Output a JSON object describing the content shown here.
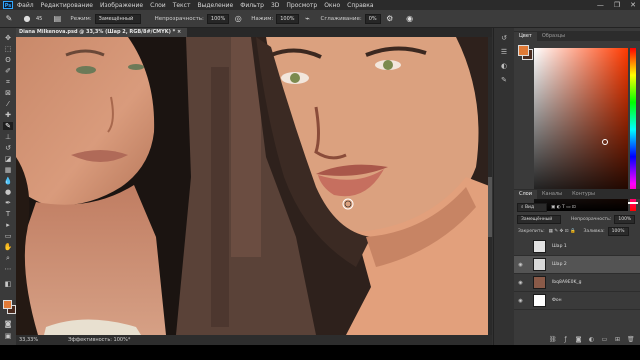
{
  "menubar": {
    "logo": "Ps",
    "items": [
      "Файл",
      "Редактирование",
      "Изображение",
      "Слои",
      "Текст",
      "Выделение",
      "Фильтр",
      "3D",
      "Просмотр",
      "Окно",
      "Справка"
    ],
    "controls": [
      "—",
      "❐",
      "✕"
    ]
  },
  "options": {
    "brush_size": "45",
    "mode_label": "Режим:",
    "mode_value": "Замещённый",
    "opacity_label": "Непрозрачность:",
    "opacity_value": "100%",
    "flow_label": "Нажим:",
    "flow_value": "100%",
    "smoothing_label": "Сглаживание:",
    "smoothing_value": "0%"
  },
  "document": {
    "tab": "Diana Milkenova.psd @ 33,3% (Шар 2, RGB/8#/CMYK) * ×",
    "zoom": "33,33%",
    "efficiency": "Эффективность: 100%*"
  },
  "colors": {
    "foreground": "#e07a36",
    "background": "#4a2b1f"
  },
  "color_panel": {
    "tabs": [
      "Цвет",
      "Образцы"
    ]
  },
  "layers_panel": {
    "tabs": [
      "Слои",
      "Каналы",
      "Контуры"
    ],
    "kind_label": "Вид",
    "blend_mode": "Замещённый",
    "opacity_label": "Непрозрачность:",
    "opacity_value": "100%",
    "lock_label": "Закрепить:",
    "fill_label": "Заливка:",
    "fill_value": "100%",
    "layers": [
      {
        "name": "Шар 1",
        "visible": false,
        "thumb": "#e2e2e2"
      },
      {
        "name": "Шар 2",
        "visible": true,
        "active": true,
        "thumb": "#d9d9d9"
      },
      {
        "name": "lbq8A9E0K_g",
        "visible": true,
        "thumb": "#8a5a48"
      },
      {
        "name": "Фон",
        "visible": true,
        "thumb": "#ffffff"
      }
    ]
  }
}
